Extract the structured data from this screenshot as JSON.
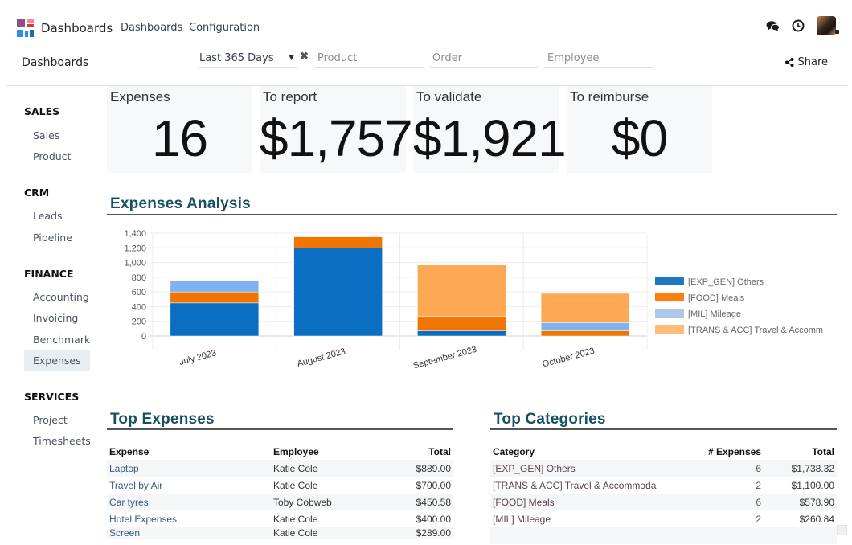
{
  "navbar": {
    "app_name": "Dashboards",
    "menu": [
      "Dashboards",
      "Configuration"
    ],
    "icons": [
      "chat-icon",
      "clock-icon",
      "user-avatar"
    ]
  },
  "control_panel": {
    "breadcrumb": "Dashboards",
    "date_filter": {
      "value": "Last 365 Days"
    },
    "filters": [
      {
        "placeholder": "Product"
      },
      {
        "placeholder": "Order"
      },
      {
        "placeholder": "Employee"
      }
    ],
    "share_label": "Share"
  },
  "sidebar": {
    "sections": [
      {
        "title": "SALES",
        "items": [
          "Sales",
          "Product"
        ]
      },
      {
        "title": "CRM",
        "items": [
          "Leads",
          "Pipeline"
        ]
      },
      {
        "title": "FINANCE",
        "items": [
          "Accounting",
          "Invoicing",
          "Benchmark",
          "Expenses"
        ]
      },
      {
        "title": "SERVICES",
        "items": [
          "Project",
          "Timesheets"
        ]
      }
    ],
    "active_item": "Expenses"
  },
  "kpis": [
    {
      "label": "Expenses",
      "value": "16"
    },
    {
      "label": "To report",
      "value": "$1,757"
    },
    {
      "label": "To validate",
      "value": "$1,921"
    },
    {
      "label": "To reimburse",
      "value": "$0"
    }
  ],
  "analysis": {
    "title": "Expenses Analysis"
  },
  "chart_data": {
    "type": "bar",
    "stacked": true,
    "title": "Expenses Analysis",
    "xlabel": "",
    "ylabel": "",
    "categories": [
      "July 2023",
      "August 2023",
      "September 2023",
      "October 2023"
    ],
    "series": [
      {
        "name": "[EXP_GEN] Others",
        "color": "#0a6fc2",
        "values": [
          450,
          1200,
          70,
          0
        ]
      },
      {
        "name": "[FOOD] Meals",
        "color": "#f07400",
        "values": [
          150,
          150,
          195,
          70
        ]
      },
      {
        "name": "[MIL] Mileage",
        "color": "#7eb2f0",
        "values": [
          150,
          0,
          0,
          110
        ]
      },
      {
        "name": "[TRANS & ACC] Travel & Accomm",
        "color": "#fda954",
        "values": [
          0,
          0,
          700,
          400
        ]
      }
    ],
    "legend_colors": [
      "#1f77c4",
      "#ff7f0e",
      "#aec7e8",
      "#ffbb78"
    ],
    "yticks": [
      "0",
      "200",
      "400",
      "600",
      "800",
      "1,000",
      "1,200",
      "1,400"
    ],
    "ylim": [
      0,
      1400
    ],
    "grid": true,
    "legend_position": "right"
  },
  "top_expenses": {
    "title": "Top Expenses",
    "columns": [
      "Expense",
      "Employee",
      "Total"
    ],
    "rows": [
      [
        "Laptop",
        "Katie Cole",
        "$889.00"
      ],
      [
        "Travel by Air",
        "Katie Cole",
        "$700.00"
      ],
      [
        "Car tyres",
        "Toby Cobweb",
        "$450.58"
      ],
      [
        "Hotel Expenses",
        "Katie Cole",
        "$400.00"
      ],
      [
        "Screen",
        "Katie Cole",
        "$289.00"
      ]
    ]
  },
  "top_categories": {
    "title": "Top Categories",
    "columns": [
      "Category",
      "# Expenses",
      "Total"
    ],
    "rows": [
      [
        "[EXP_GEN] Others",
        "6",
        "$1,738.32"
      ],
      [
        "[TRANS & ACC] Travel & Accommoda",
        "2",
        "$1,100.00"
      ],
      [
        "[FOOD] Meals",
        "6",
        "$578.90"
      ],
      [
        "[MIL] Mileage",
        "2",
        "$260.84"
      ]
    ]
  }
}
